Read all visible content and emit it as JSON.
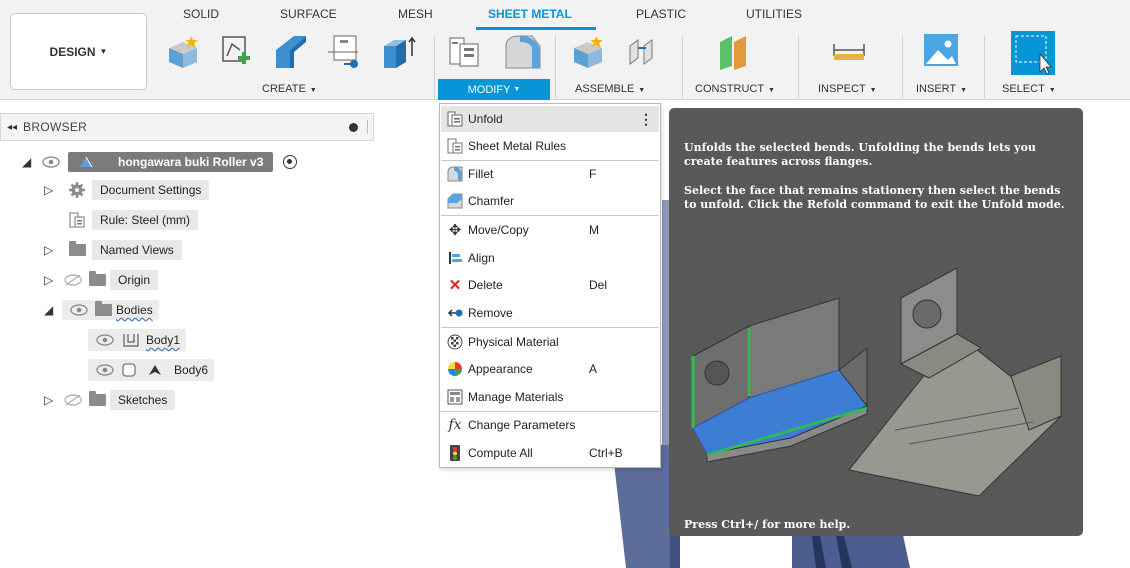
{
  "toolbar": {
    "workspace": "DESIGN",
    "tabs": [
      "SOLID",
      "SURFACE",
      "MESH",
      "SHEET METAL",
      "PLASTIC",
      "UTILITIES"
    ],
    "active_tab": "SHEET METAL",
    "groups": [
      "CREATE",
      "MODIFY",
      "ASSEMBLE",
      "CONSTRUCT",
      "INSPECT",
      "INSERT",
      "SELECT"
    ]
  },
  "browser": {
    "title": "BROWSER",
    "root": "hongawara buki Roller v3",
    "items": {
      "document_settings": "Document Settings",
      "rule": "Rule: Steel (mm)",
      "named_views": "Named Views",
      "origin": "Origin",
      "bodies": "Bodies",
      "body1": "Body1",
      "body6": "Body6",
      "sketches": "Sketches"
    }
  },
  "menu": {
    "items": [
      {
        "label": "Unfold",
        "shortcut": "",
        "icon": "unfold-icon"
      },
      {
        "label": "Sheet Metal Rules",
        "shortcut": "",
        "icon": "sheet-metal-rules-icon"
      },
      {
        "label": "Fillet",
        "shortcut": "F",
        "icon": "fillet-icon"
      },
      {
        "label": "Chamfer",
        "shortcut": "",
        "icon": "chamfer-icon"
      },
      {
        "label": "Move/Copy",
        "shortcut": "M",
        "icon": "move-icon"
      },
      {
        "label": "Align",
        "shortcut": "",
        "icon": "align-icon"
      },
      {
        "label": "Delete",
        "shortcut": "Del",
        "icon": "delete-icon"
      },
      {
        "label": "Remove",
        "shortcut": "",
        "icon": "remove-icon"
      },
      {
        "label": "Physical Material",
        "shortcut": "",
        "icon": "physical-material-icon"
      },
      {
        "label": "Appearance",
        "shortcut": "A",
        "icon": "appearance-icon"
      },
      {
        "label": "Manage Materials",
        "shortcut": "",
        "icon": "manage-materials-icon"
      },
      {
        "label": "Change Parameters",
        "shortcut": "",
        "icon": "fx-icon"
      },
      {
        "label": "Compute All",
        "shortcut": "Ctrl+B",
        "icon": "compute-all-icon"
      }
    ]
  },
  "tooltip": {
    "title": "Unfolds the selected bends. Unfolding the bends lets you create features across flanges.",
    "body": "Select the face that remains stationery then select the bends to unfold. Click the Refold command to exit the Unfold mode.",
    "footer": "Press Ctrl+/ for more help."
  },
  "colors": {
    "accent": "#0696d7",
    "tooltip_bg": "#595959",
    "menu_hover": "#e5e5e5"
  }
}
